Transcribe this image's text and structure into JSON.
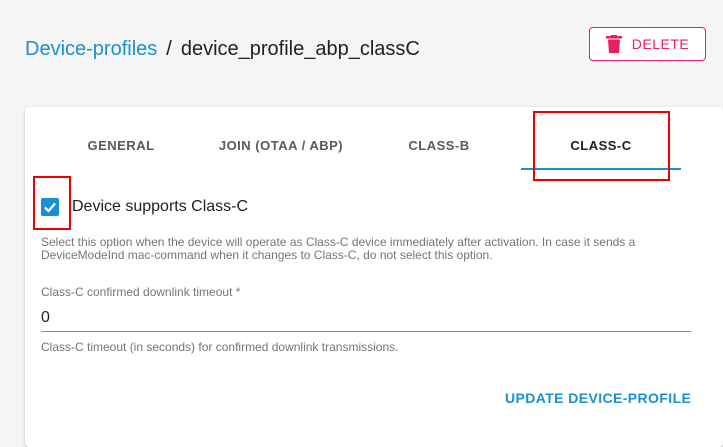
{
  "breadcrumb": {
    "parent": "Device-profiles",
    "separator": "/",
    "current": "device_profile_abp_classC"
  },
  "header": {
    "delete_label": "DELETE",
    "delete_icon": "trash-icon"
  },
  "tabs": [
    {
      "label": "GENERAL",
      "active": false
    },
    {
      "label": "JOIN (OTAA / ABP)",
      "active": false
    },
    {
      "label": "CLASS-B",
      "active": false
    },
    {
      "label": "CLASS-C",
      "active": true
    }
  ],
  "form": {
    "supports_classc": {
      "label": "Device supports Class-C",
      "checked": true,
      "helper": "Select this option when the device will operate as Class-C device immediately after activation. In case it sends a DeviceModeInd mac-command when it changes to Class-C, do not select this option."
    },
    "timeout": {
      "label": "Class-C confirmed downlink timeout *",
      "value": "0",
      "helper": "Class-C timeout (in seconds) for confirmed downlink transmissions."
    },
    "submit_label": "UPDATE DEVICE-PROFILE"
  },
  "colors": {
    "accent": "#1a8fd1",
    "danger": "#e91e63",
    "highlight": "#ee0000"
  }
}
